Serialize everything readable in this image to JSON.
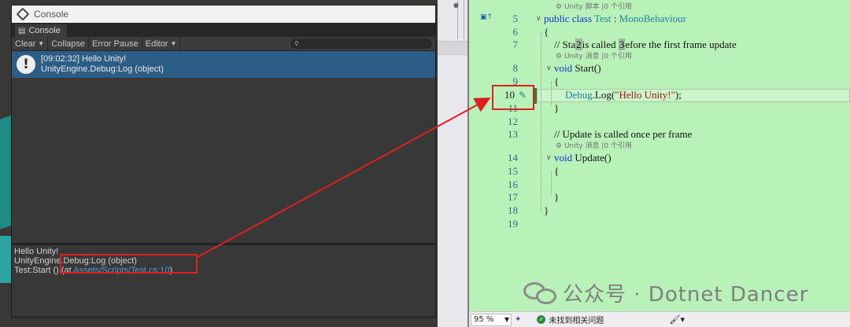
{
  "console": {
    "title": "Console",
    "tab_label": "Console",
    "toolbar": {
      "clear": "Clear",
      "collapse": "Collapse",
      "error_pause": "Error Pause",
      "editor": "Editor"
    },
    "log_entry": {
      "line1": "[09:02:32] Hello Unity!",
      "line2": "UnityEngine.Debug:Log (object)"
    },
    "detail": {
      "line1": "Hello Unity!",
      "line2": "UnityEngine.Debug:Log (object)",
      "line3_prefix": "Test:Start () (at ",
      "line3_link": "Assets/Scripts/Test.cs:10",
      "line3_suffix": ")"
    }
  },
  "editor": {
    "codelens_class": "Unity 脚本 |0 个引用",
    "codelens_start": "Unity 消息 |0 个引用",
    "codelens_update": "Unity 消息 |0 个引用",
    "line_numbers": [
      "5",
      "6",
      "7",
      "8",
      "9",
      "10",
      "11",
      "12",
      "13",
      "14",
      "15",
      "16",
      "17",
      "18",
      "19"
    ],
    "line5": {
      "kw1": "public",
      "kw2": "class",
      "name": "Test",
      "sep": " : ",
      "base": "MonoBehaviour"
    },
    "line6": "{",
    "line7": {
      "a": "// Sta",
      "m1": "2",
      "b": "is called ",
      "m2": "3",
      "c": "efore the first frame update"
    },
    "line8": {
      "kw": "void",
      "name": " Start()"
    },
    "line9": "{",
    "line10": {
      "obj": "Debug",
      "dot": ".",
      "method": "Log(",
      "str": "\"Hello Unity!\"",
      "end": ");"
    },
    "line11": "}",
    "line13": "// Update is called once per frame",
    "line14": {
      "kw": "void",
      "name": " Update()"
    },
    "line15": "{",
    "line17": "}",
    "line18": "}"
  },
  "status_bar": {
    "zoom": "95 %",
    "issues": "未找到相关问题"
  },
  "watermark": {
    "text": "公众号 · Dotnet Dancer"
  },
  "colors": {
    "unity_selection": "#2c5d87",
    "vs_background": "#b9f2b9",
    "highlight_red": "#e02020"
  }
}
